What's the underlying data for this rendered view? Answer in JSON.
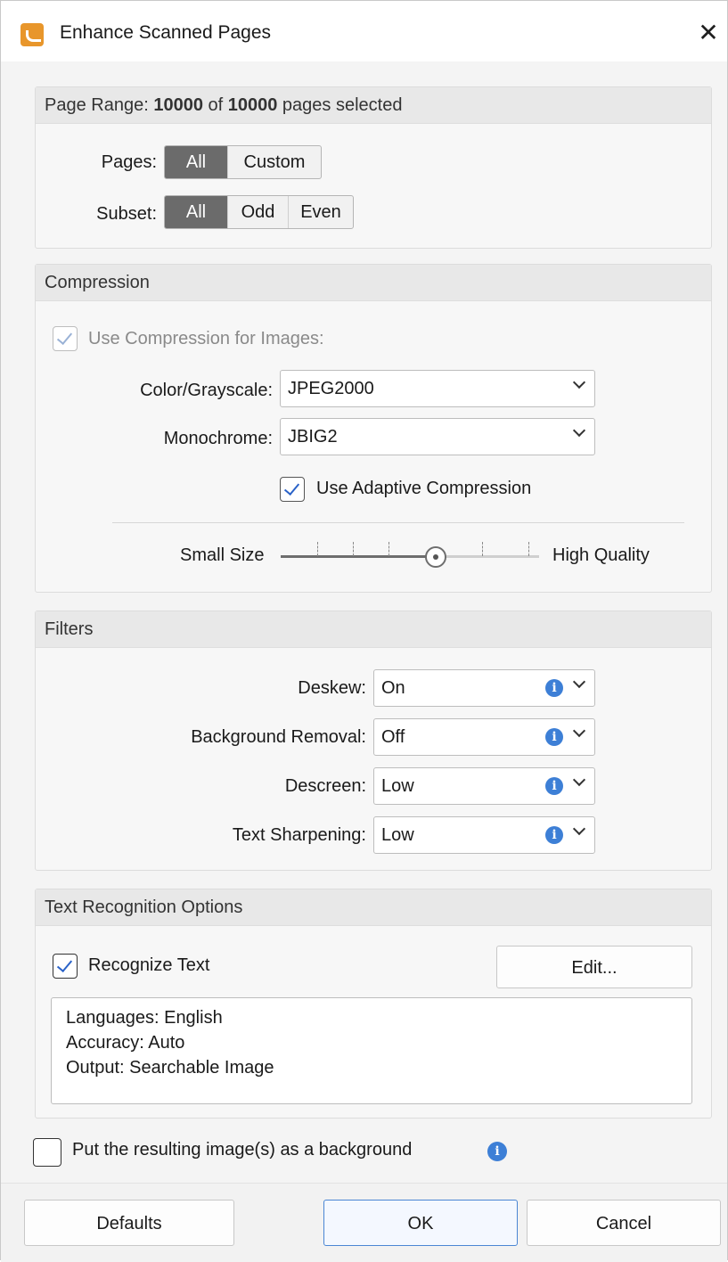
{
  "window": {
    "title": "Enhance Scanned Pages",
    "close_symbol": "✕",
    "app_icon": "pdf-xchange-app-icon"
  },
  "page_range": {
    "header": {
      "prefix": "Page Range: ",
      "selected": "10000",
      "of": " of ",
      "total": "10000",
      "suffix": " pages selected"
    },
    "pages_label": "Pages:",
    "pages_options": [
      "All",
      "Custom"
    ],
    "pages_selected": "All",
    "subset_label": "Subset:",
    "subset_options": [
      "All",
      "Odd",
      "Even"
    ],
    "subset_selected": "All"
  },
  "compression": {
    "header": "Compression",
    "use_compression_label": "Use Compression for Images:",
    "use_compression_checked": true,
    "color_label": "Color/Grayscale:",
    "color_value": "JPEG2000",
    "mono_label": "Monochrome:",
    "mono_value": "JBIG2",
    "adaptive_label": "Use Adaptive Compression",
    "adaptive_checked": true,
    "slider_min_label": "Small Size",
    "slider_max_label": "High Quality",
    "slider_level": 0.6
  },
  "filters": {
    "header": "Filters",
    "items": [
      {
        "label": "Deskew:",
        "value": "On"
      },
      {
        "label": "Background Removal:",
        "value": "Off"
      },
      {
        "label": "Descreen:",
        "value": "Low"
      },
      {
        "label": "Text Sharpening:",
        "value": "Low"
      }
    ]
  },
  "ocr": {
    "header": "Text Recognition Options",
    "recognize_label": "Recognize Text",
    "recognize_checked": true,
    "edit_label": "Edit...",
    "summary": [
      "Languages: English",
      "Accuracy: Auto",
      "Output: Searchable Image"
    ]
  },
  "background_option": {
    "label": "Put the resulting image(s) as a background",
    "checked": false
  },
  "buttons": {
    "defaults": "Defaults",
    "ok": "OK",
    "cancel": "Cancel"
  },
  "colors": {
    "accent": "#2a62c8",
    "info": "#3d7fd6",
    "segment_active": "#6b6b6b"
  }
}
